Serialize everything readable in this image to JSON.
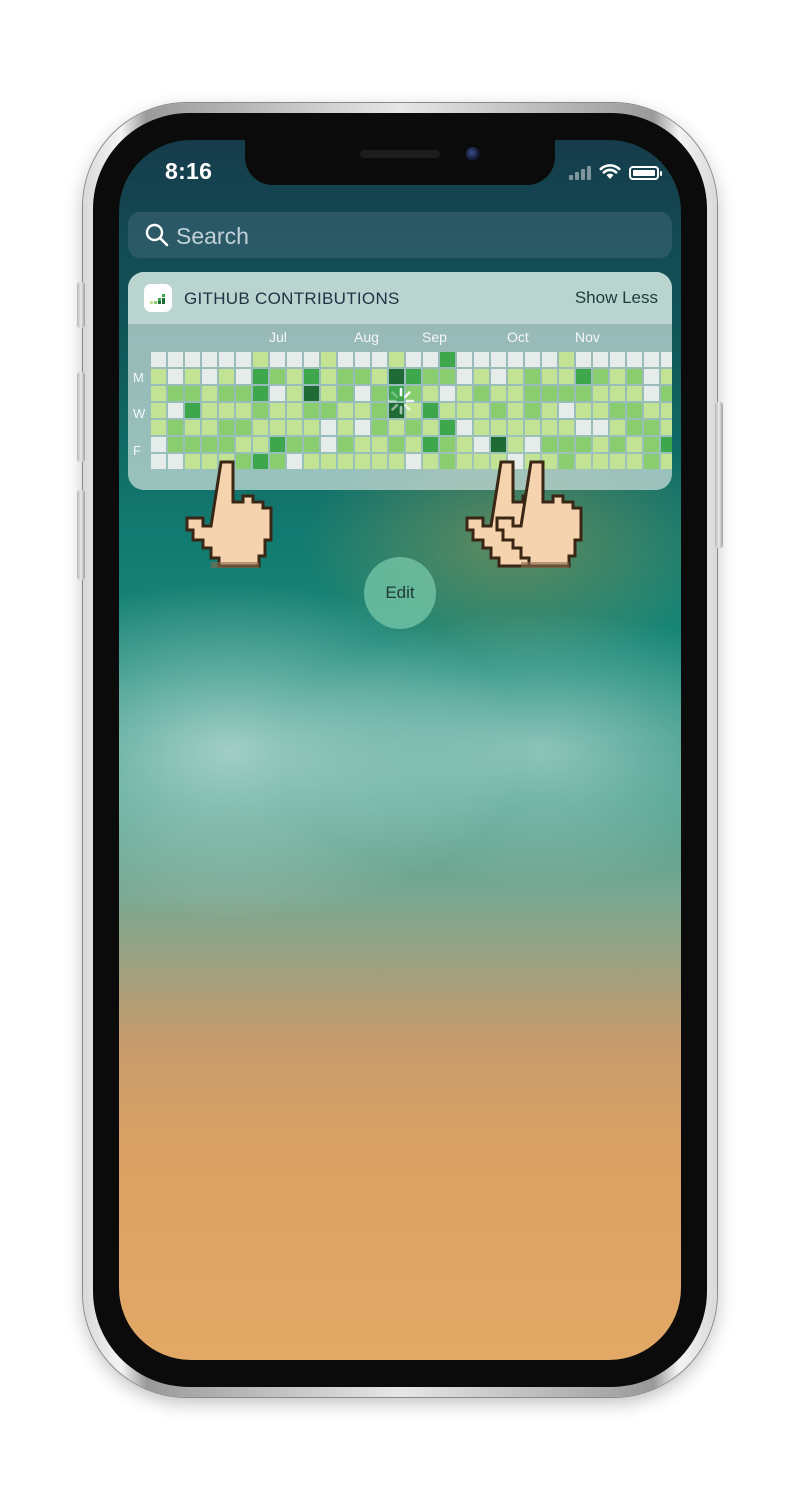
{
  "status_bar": {
    "time": "8:16",
    "icons": [
      "signal-icon",
      "wifi-icon",
      "battery-icon"
    ]
  },
  "search": {
    "placeholder": "Search",
    "icon": "search-icon"
  },
  "widget": {
    "title": "GITHUB CONTRIBUTIONS",
    "toggle_label": "Show Less",
    "icon": "contributions-graph-icon",
    "months": [
      "Jul",
      "Aug",
      "Sep",
      "Oct",
      "Nov"
    ],
    "day_labels": [
      "M",
      "W",
      "F"
    ],
    "loading": true,
    "colors": [
      "#e6ece9",
      "#c3e394",
      "#8acd6f",
      "#3ea64d",
      "#1e6b35"
    ],
    "weeks": [
      [
        0,
        1,
        1,
        1,
        1,
        0,
        0
      ],
      [
        0,
        0,
        2,
        0,
        2,
        2,
        0
      ],
      [
        0,
        1,
        2,
        3,
        1,
        2,
        1
      ],
      [
        0,
        0,
        1,
        1,
        1,
        2,
        1
      ],
      [
        0,
        1,
        2,
        1,
        2,
        2,
        1
      ],
      [
        0,
        0,
        2,
        1,
        2,
        1,
        2
      ],
      [
        1,
        3,
        3,
        2,
        1,
        1,
        3
      ],
      [
        0,
        2,
        0,
        1,
        1,
        3,
        2
      ],
      [
        0,
        1,
        1,
        1,
        1,
        2,
        0
      ],
      [
        0,
        3,
        4,
        2,
        1,
        2,
        1
      ],
      [
        1,
        1,
        1,
        2,
        0,
        0,
        1
      ],
      [
        0,
        2,
        2,
        1,
        1,
        2,
        1
      ],
      [
        0,
        2,
        0,
        1,
        0,
        1,
        1
      ],
      [
        0,
        1,
        2,
        2,
        2,
        1,
        1
      ],
      [
        1,
        4,
        3,
        4,
        1,
        2,
        1
      ],
      [
        0,
        3,
        2,
        1,
        2,
        1,
        0
      ],
      [
        0,
        2,
        1,
        3,
        1,
        3,
        1
      ],
      [
        3,
        2,
        0,
        1,
        3,
        2,
        2
      ],
      [
        0,
        0,
        1,
        1,
        0,
        1,
        1
      ],
      [
        0,
        1,
        2,
        1,
        1,
        0,
        1
      ],
      [
        0,
        0,
        1,
        2,
        1,
        4,
        1
      ],
      [
        0,
        1,
        1,
        1,
        1,
        1,
        0
      ],
      [
        0,
        2,
        2,
        2,
        1,
        0,
        1
      ],
      [
        0,
        1,
        2,
        1,
        1,
        2,
        1
      ],
      [
        1,
        1,
        2,
        0,
        1,
        2,
        2
      ],
      [
        0,
        3,
        2,
        1,
        0,
        2,
        1
      ],
      [
        0,
        2,
        1,
        1,
        0,
        1,
        1
      ],
      [
        0,
        1,
        1,
        2,
        1,
        2,
        1
      ],
      [
        0,
        2,
        1,
        2,
        2,
        1,
        1
      ],
      [
        0,
        0,
        0,
        1,
        2,
        2,
        2
      ],
      [
        0,
        1,
        2,
        1,
        1,
        3,
        1
      ],
      [
        0,
        2,
        1,
        1,
        2,
        1,
        1
      ],
      [
        0,
        2,
        1,
        1,
        3,
        1,
        0
      ],
      [
        0,
        3,
        1,
        4,
        2,
        3,
        1
      ],
      [
        0,
        3,
        3,
        4,
        0,
        4,
        0
      ]
    ]
  },
  "edit": {
    "label": "Edit"
  }
}
